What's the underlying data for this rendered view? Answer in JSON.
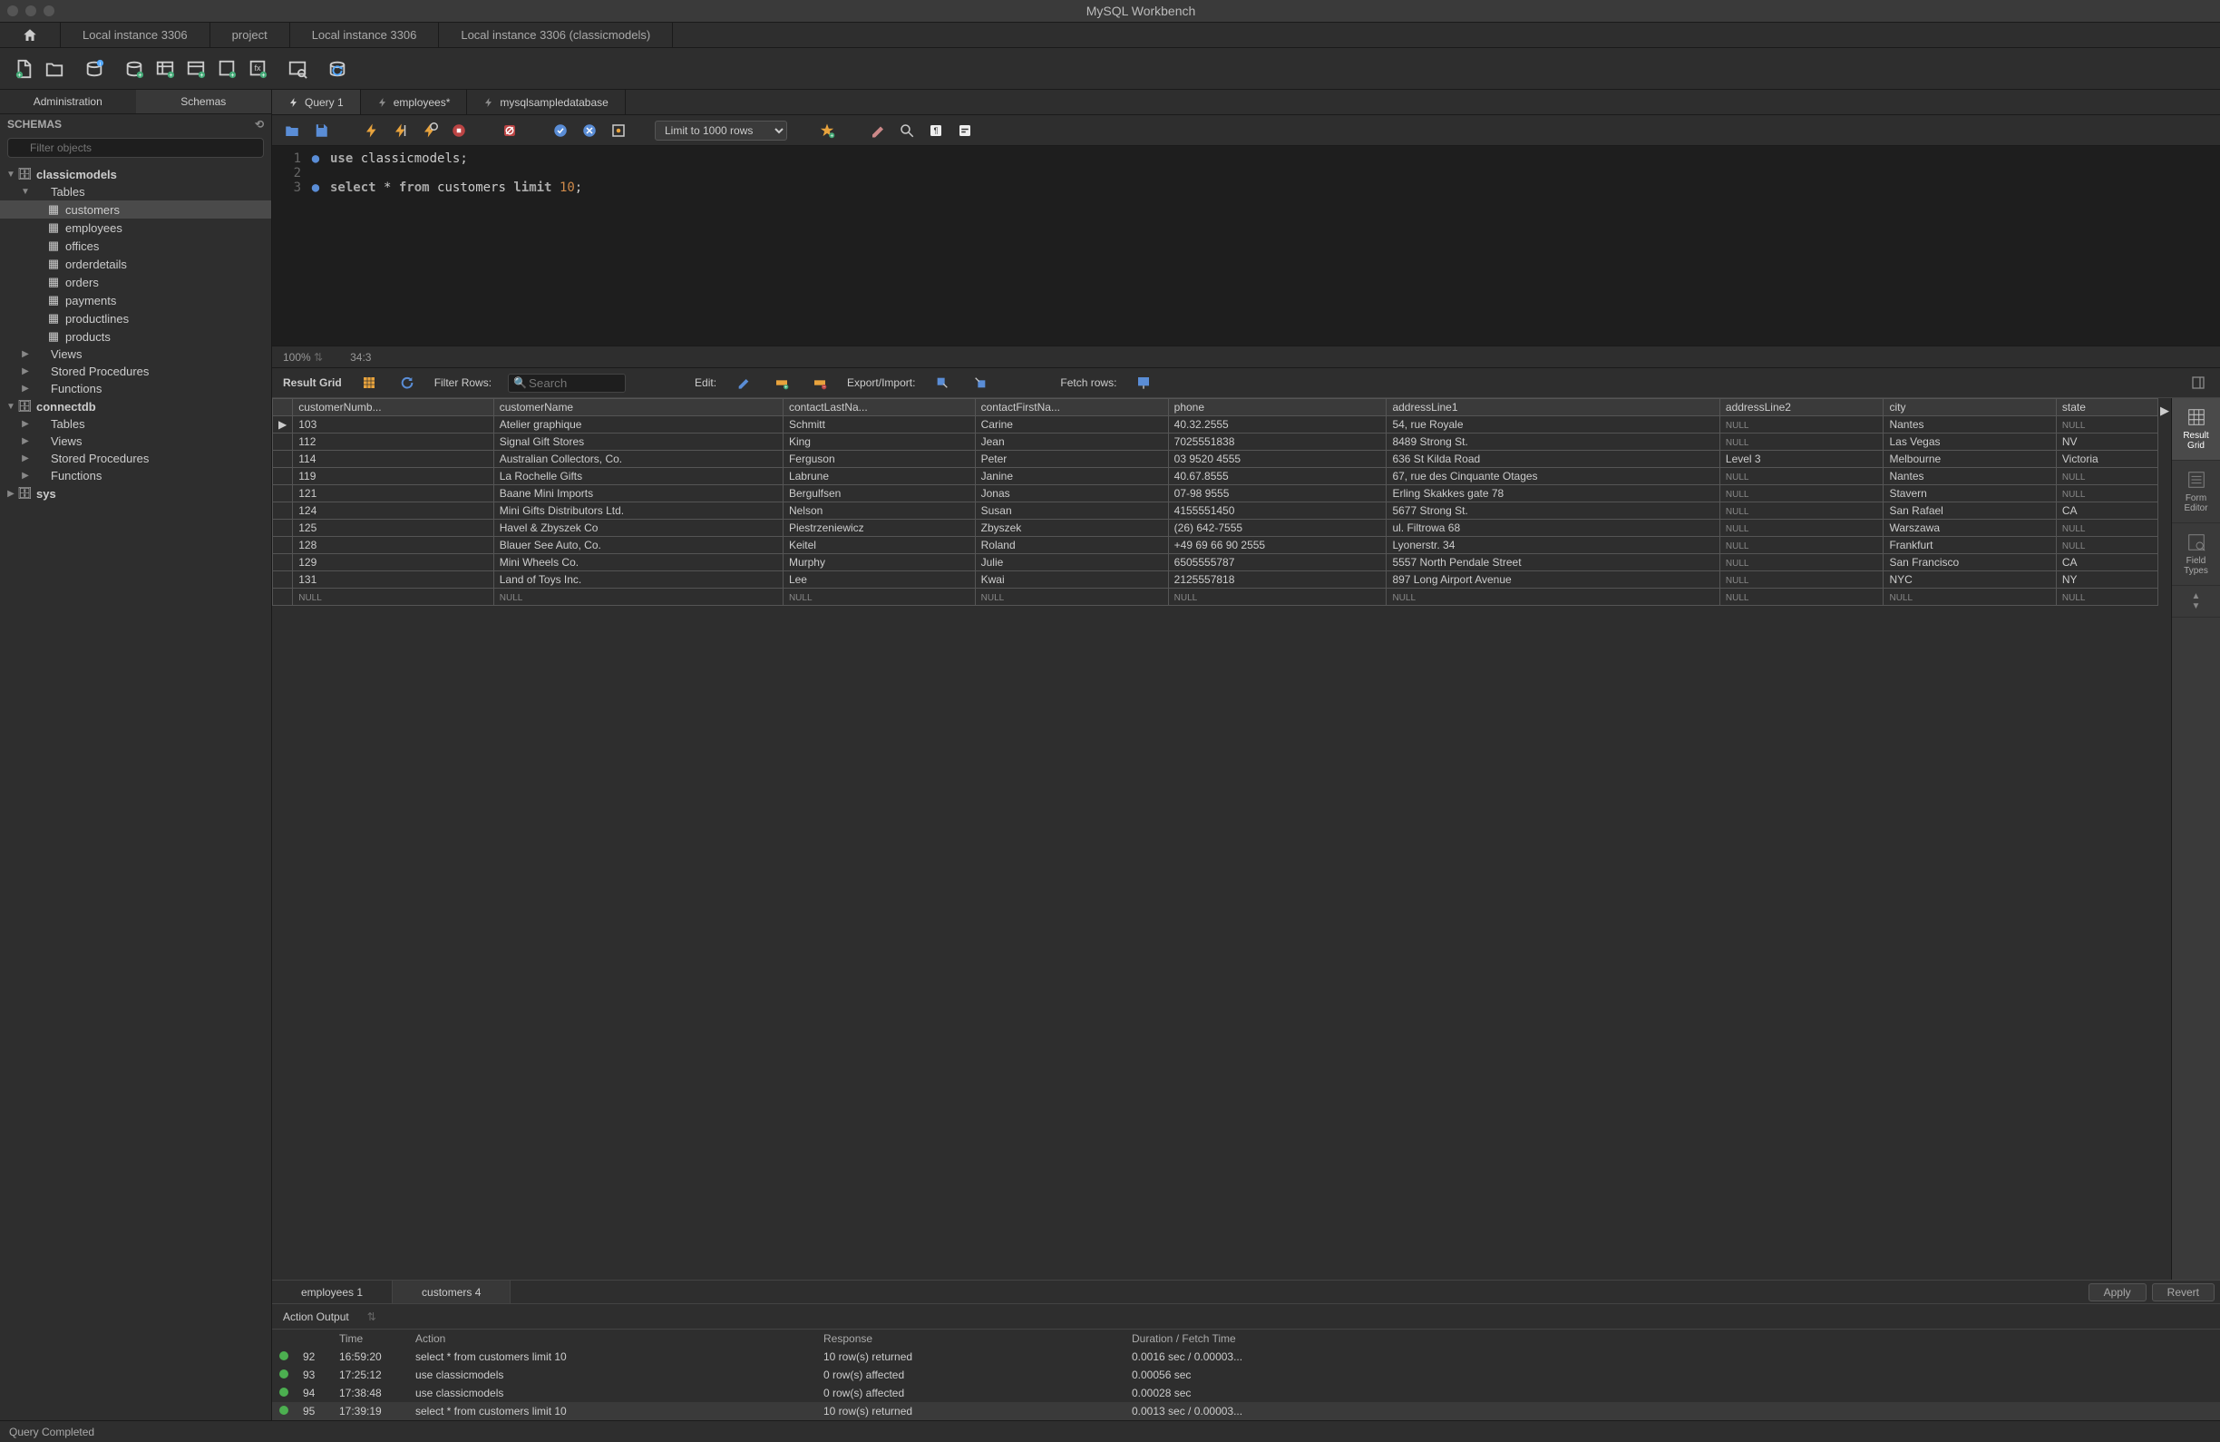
{
  "app_title": "MySQL Workbench",
  "connection_tabs": [
    "Local instance 3306",
    "project",
    "Local instance 3306",
    "Local instance 3306 (classicmodels)"
  ],
  "sidebar": {
    "tabs": {
      "admin": "Administration",
      "schemas": "Schemas"
    },
    "header": "SCHEMAS",
    "filter_placeholder": "Filter objects",
    "schemas": [
      {
        "name": "classicmodels",
        "expanded": true,
        "children": [
          {
            "name": "Tables",
            "expanded": true,
            "children": [
              {
                "name": "customers",
                "selected": true
              },
              {
                "name": "employees"
              },
              {
                "name": "offices"
              },
              {
                "name": "orderdetails"
              },
              {
                "name": "orders"
              },
              {
                "name": "payments"
              },
              {
                "name": "productlines"
              },
              {
                "name": "products"
              }
            ]
          },
          {
            "name": "Views"
          },
          {
            "name": "Stored Procedures"
          },
          {
            "name": "Functions"
          }
        ]
      },
      {
        "name": "connectdb",
        "expanded": true,
        "children": [
          {
            "name": "Tables"
          },
          {
            "name": "Views"
          },
          {
            "name": "Stored Procedures"
          },
          {
            "name": "Functions"
          }
        ]
      },
      {
        "name": "sys",
        "expanded": false
      }
    ]
  },
  "editor_tabs": [
    "Query 1",
    "employees*",
    "mysqlsampledatabase"
  ],
  "limit_label": "Limit to 1000 rows",
  "code": {
    "line1_kw": "use",
    "line1_ident": "classicmodels",
    "line1_end": ";",
    "line3_kw1": "select",
    "line3_star": "*",
    "line3_kw2": "from",
    "line3_ident": "customers",
    "line3_kw3": "limit",
    "line3_num": "10",
    "line3_end": ";"
  },
  "zoom": "100%",
  "cursor_pos": "34:3",
  "result_toolbar": {
    "title": "Result Grid",
    "filter_rows_label": "Filter Rows:",
    "search_placeholder": "Search",
    "edit_label": "Edit:",
    "export_label": "Export/Import:",
    "fetch_label": "Fetch rows:"
  },
  "grid": {
    "columns": [
      "customerNumb...",
      "customerName",
      "contactLastNa...",
      "contactFirstNa...",
      "phone",
      "addressLine1",
      "addressLine2",
      "city",
      "state"
    ],
    "rows": [
      [
        "103",
        "Atelier graphique",
        "Schmitt",
        "Carine",
        "40.32.2555",
        "54, rue Royale",
        null,
        "Nantes",
        null
      ],
      [
        "112",
        "Signal Gift Stores",
        "King",
        "Jean",
        "7025551838",
        "8489 Strong St.",
        null,
        "Las Vegas",
        "NV"
      ],
      [
        "114",
        "Australian Collectors, Co.",
        "Ferguson",
        "Peter",
        "03 9520 4555",
        "636 St Kilda Road",
        "Level 3",
        "Melbourne",
        "Victoria"
      ],
      [
        "119",
        "La Rochelle Gifts",
        "Labrune",
        "Janine",
        "40.67.8555",
        "67, rue des Cinquante Otages",
        null,
        "Nantes",
        null
      ],
      [
        "121",
        "Baane Mini Imports",
        "Bergulfsen",
        "Jonas",
        "07-98 9555",
        "Erling Skakkes gate 78",
        null,
        "Stavern",
        null
      ],
      [
        "124",
        "Mini Gifts Distributors Ltd.",
        "Nelson",
        "Susan",
        "4155551450",
        "5677 Strong St.",
        null,
        "San Rafael",
        "CA"
      ],
      [
        "125",
        "Havel & Zbyszek Co",
        "Piestrzeniewicz",
        "Zbyszek",
        "(26) 642-7555",
        "ul. Filtrowa 68",
        null,
        "Warszawa",
        null
      ],
      [
        "128",
        "Blauer See Auto, Co.",
        "Keitel",
        "Roland",
        "+49 69 66 90 2555",
        "Lyonerstr. 34",
        null,
        "Frankfurt",
        null
      ],
      [
        "129",
        "Mini Wheels Co.",
        "Murphy",
        "Julie",
        "6505555787",
        "5557 North Pendale Street",
        null,
        "San Francisco",
        "CA"
      ],
      [
        "131",
        "Land of Toys Inc.",
        "Lee",
        "Kwai",
        "2125557818",
        "897 Long Airport Avenue",
        null,
        "NYC",
        "NY"
      ],
      [
        null,
        null,
        null,
        null,
        null,
        null,
        null,
        null,
        null
      ]
    ]
  },
  "side_panel": [
    "Result Grid",
    "Form Editor",
    "Field Types"
  ],
  "result_tabs": [
    "employees 1",
    "customers 4"
  ],
  "apply_label": "Apply",
  "revert_label": "Revert",
  "action_output_label": "Action Output",
  "action_columns": [
    "",
    "",
    "Time",
    "Action",
    "Response",
    "Duration / Fetch Time"
  ],
  "actions": [
    {
      "num": "92",
      "time": "16:59:20",
      "action": "select * from customers limit 10",
      "response": "10 row(s) returned",
      "duration": "0.0016 sec / 0.00003..."
    },
    {
      "num": "93",
      "time": "17:25:12",
      "action": "use classicmodels",
      "response": "0 row(s) affected",
      "duration": "0.00056 sec"
    },
    {
      "num": "94",
      "time": "17:38:48",
      "action": "use classicmodels",
      "response": "0 row(s) affected",
      "duration": "0.00028 sec"
    },
    {
      "num": "95",
      "time": "17:39:19",
      "action": "select * from customers limit 10",
      "response": "10 row(s) returned",
      "duration": "0.0013 sec / 0.00003..."
    }
  ],
  "statusbar": "Query Completed"
}
